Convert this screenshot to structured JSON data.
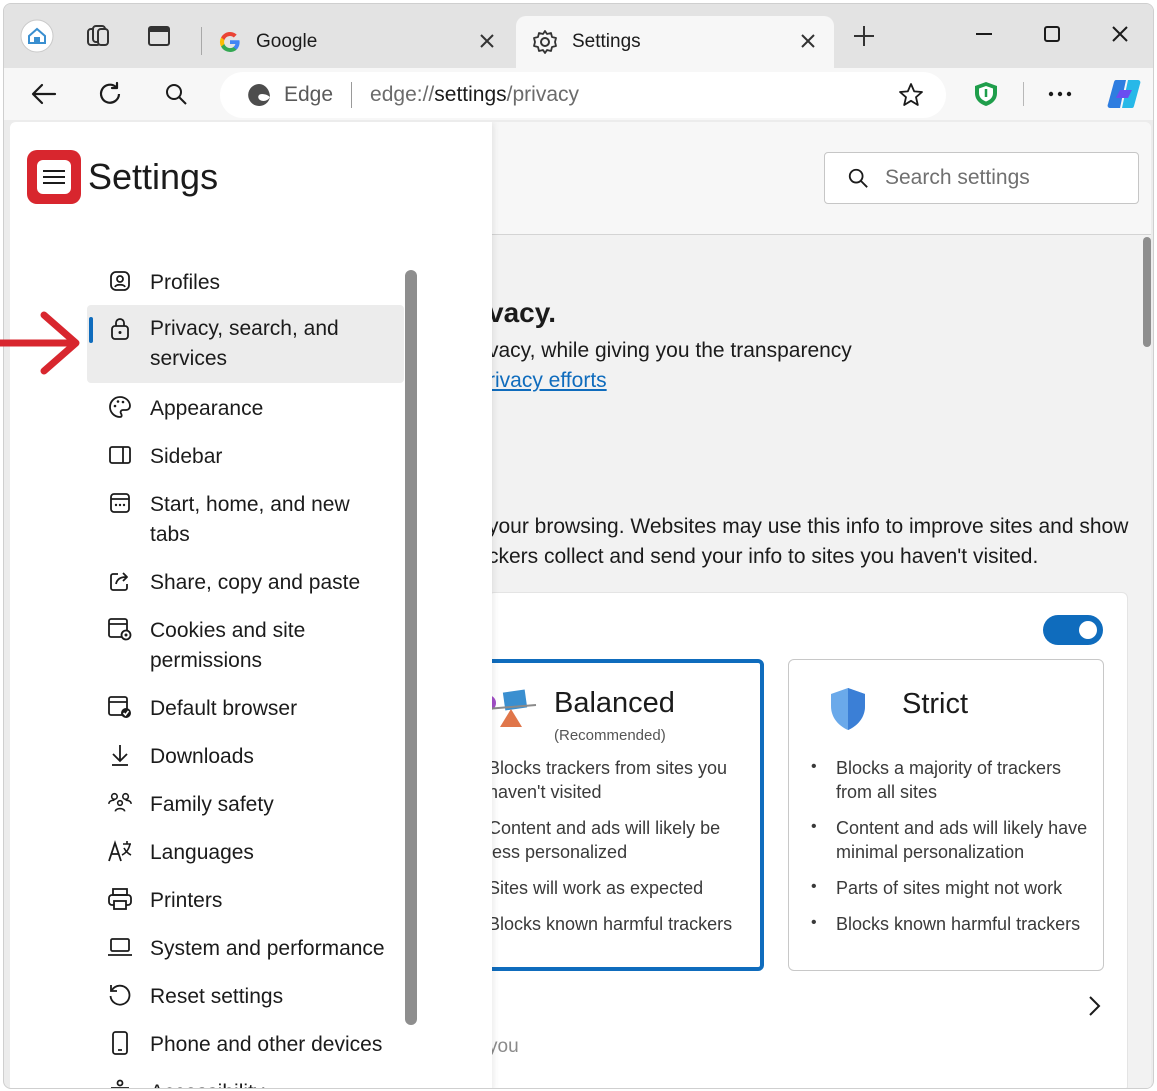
{
  "browser": {
    "tabs": [
      {
        "label": "Google",
        "active": false
      },
      {
        "label": "Settings",
        "active": true
      }
    ],
    "address": {
      "edge_label": "Edge",
      "url_prefix": "edge://",
      "url_host": "settings",
      "url_path": "/privacy"
    }
  },
  "settings": {
    "title": "Settings",
    "search_placeholder": "Search settings",
    "nav_items": [
      {
        "label": "Profiles",
        "icon": "profiles-icon"
      },
      {
        "label": "Privacy, search, and",
        "label2": "services",
        "icon": "lock-icon",
        "selected": true
      },
      {
        "label": "Appearance",
        "icon": "palette-icon"
      },
      {
        "label": "Sidebar",
        "icon": "sidebar-icon"
      },
      {
        "label": "Start, home, and new",
        "label2": "tabs",
        "icon": "start-home-icon"
      },
      {
        "label": "Share, copy and paste",
        "icon": "share-icon"
      },
      {
        "label": "Cookies and site",
        "label2": "permissions",
        "icon": "cookies-icon"
      },
      {
        "label": "Default browser",
        "icon": "default-browser-icon"
      },
      {
        "label": "Downloads",
        "icon": "download-icon"
      },
      {
        "label": "Family safety",
        "icon": "family-icon"
      },
      {
        "label": "Languages",
        "icon": "languages-icon"
      },
      {
        "label": "Printers",
        "icon": "printer-icon"
      },
      {
        "label": "System and performance",
        "icon": "laptop-icon"
      },
      {
        "label": "Reset settings",
        "icon": "reset-icon"
      },
      {
        "label": "Phone and other devices",
        "icon": "phone-icon"
      },
      {
        "label": "Accessibility",
        "icon": "accessibility-icon"
      }
    ]
  },
  "main": {
    "privacy_title": "vacy.",
    "privacy_desc": "vacy, while giving you the transparency",
    "privacy_link": "rivacy efforts",
    "tracking_desc1": "your browsing. Websites may use this info to improve sites and show",
    "tracking_desc2": "ckers collect and send your info to sites you haven't visited.",
    "tracking_toggle_on": true,
    "balanced": {
      "title": "Balanced",
      "subtitle": "(Recommended)",
      "items": [
        "Blocks trackers from sites you haven't visited",
        "Content and ads will likely be less personalized",
        "Sites will work as expected",
        "Blocks known harmful trackers"
      ]
    },
    "strict": {
      "title": "Strict",
      "items": [
        "Blocks a majority of trackers from all sites",
        "Content and ads will likely have minimal personalization",
        "Parts of sites might not work",
        "Blocks known harmful trackers"
      ]
    },
    "faded_text": "you"
  },
  "colors": {
    "accent": "#0f6cbd",
    "annotation_red": "#d8262e"
  }
}
